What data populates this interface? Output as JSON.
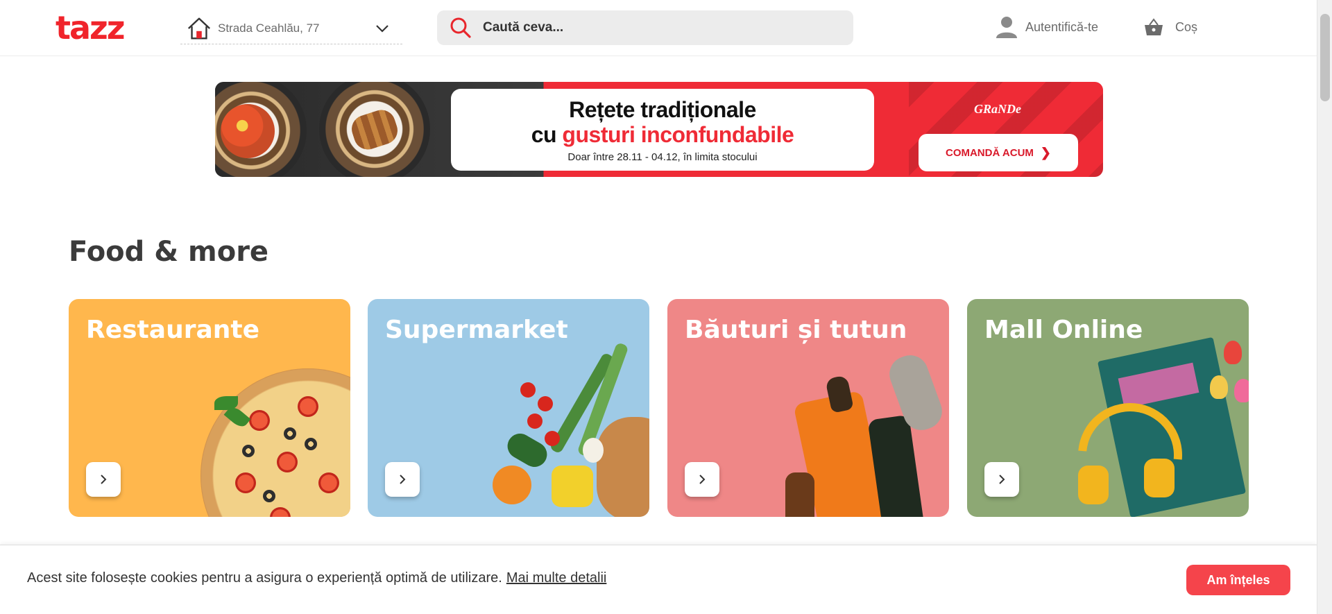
{
  "header": {
    "logo": "tazz",
    "address": "Strada Ceahlău, 77",
    "search_placeholder": "Caută ceva...",
    "login_label": "Autentifică-te",
    "cart_label": "Coș"
  },
  "banner": {
    "title_line1": "Rețete tradiționale",
    "title_line2_prefix": "cu ",
    "title_line2_highlight": "gusturi inconfundabile",
    "subtitle": "Doar între 28.11 - 04.12, în limita stocului",
    "brand": "GRaNDe",
    "cta_label": "COMANDĂ ACUM",
    "colors": {
      "red": "#ef2b36",
      "dark": "#2a2a2a"
    }
  },
  "section": {
    "title": "Food & more",
    "cards": [
      {
        "title": "Restaurante",
        "color": "#ffb74d"
      },
      {
        "title": "Supermarket",
        "color": "#9ecae6"
      },
      {
        "title": "Băuturi și tutun",
        "color": "#ef8787"
      },
      {
        "title": "Mall Online",
        "color": "#8da874"
      }
    ]
  },
  "cookie": {
    "message": "Acest site folosește cookies pentru a asigura o experiență optimă de utilizare.",
    "link": "Mai multe detalii",
    "accept": "Am înțeles"
  },
  "colors": {
    "brand": "#f0242b",
    "accept_button": "#f5444b"
  }
}
